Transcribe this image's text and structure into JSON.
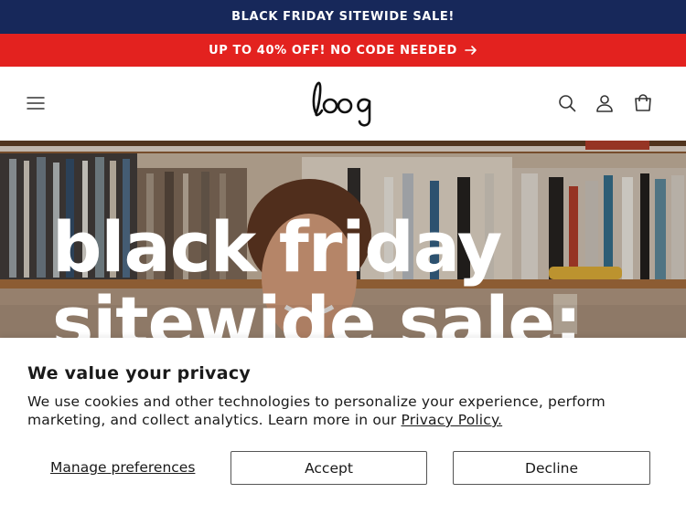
{
  "announcement": {
    "top_text": "BLACK FRIDAY SITEWIDE SALE!",
    "promo_text": "UP TO 40% OFF! NO CODE NEEDED",
    "top_bg": "#17285a",
    "promo_bg": "#e3221f"
  },
  "header": {
    "logo_text": "loog",
    "icons": [
      "menu-icon",
      "search-icon",
      "account-icon",
      "cart-icon"
    ]
  },
  "hero": {
    "line1": "black friday",
    "line2": "sitewide sale:"
  },
  "consent": {
    "title": "We value your privacy",
    "body": "We use cookies and other technologies to personalize your experience, perform marketing, and collect analytics. Learn more in our ",
    "link": "Privacy Policy.",
    "manage_label": "Manage preferences",
    "accept_label": "Accept",
    "decline_label": "Decline"
  }
}
